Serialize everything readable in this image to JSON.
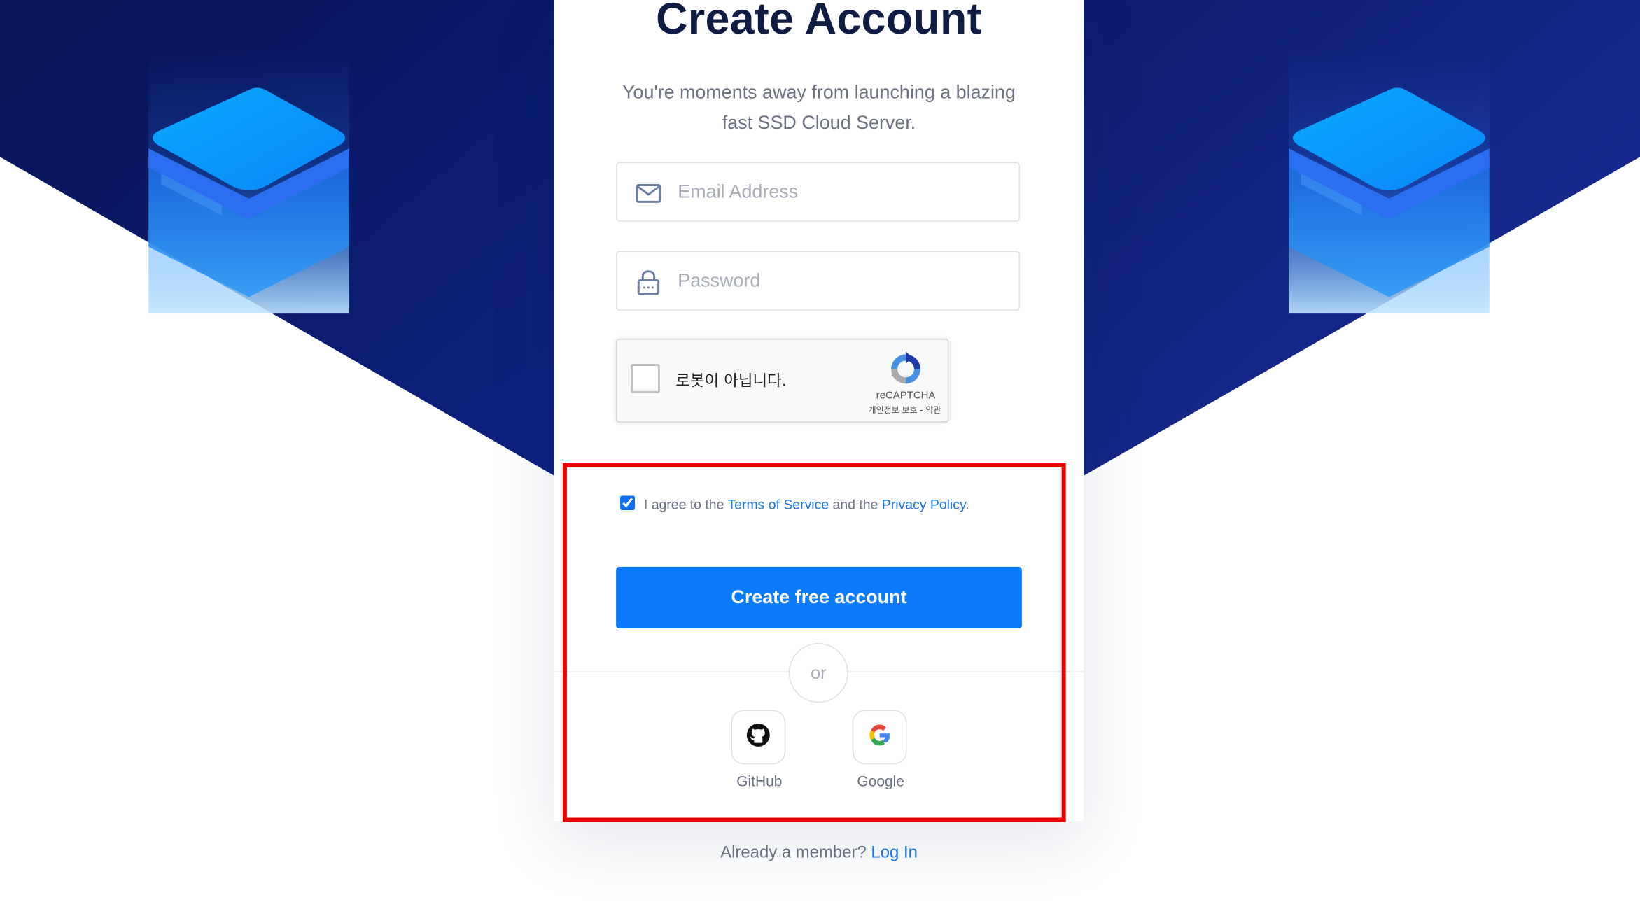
{
  "page": {
    "title": "Create Account",
    "subtitle": "You're moments away from launching a blazing fast SSD Cloud Server."
  },
  "form": {
    "email_placeholder": "Email Address",
    "password_placeholder": "Password",
    "email_icon": "envelope-icon",
    "password_icon": "lock-icon"
  },
  "recaptcha": {
    "label": "로봇이 아닙니다.",
    "brand": "reCAPTCHA",
    "links": "개인정보 보호 - 약관",
    "checked": false
  },
  "agreement": {
    "checked": true,
    "prefix": "I agree to the",
    "terms_link": "Terms of Service",
    "middle": "and the",
    "privacy_link": "Privacy Policy",
    "suffix": "."
  },
  "actions": {
    "create_button": "Create free account",
    "divider_text": "or",
    "social": [
      {
        "label": "GitHub",
        "icon": "github-icon"
      },
      {
        "label": "Google",
        "icon": "google-icon"
      }
    ]
  },
  "footer": {
    "prompt": "Already a member?",
    "login_link": "Log In"
  },
  "colors": {
    "primary_button": "#0b7bfd",
    "link": "#1a73e8",
    "title": "#111c44",
    "background_dark": "#0a1a63",
    "background_light": "#1a2c9a",
    "highlight_border": "#ee0000"
  }
}
